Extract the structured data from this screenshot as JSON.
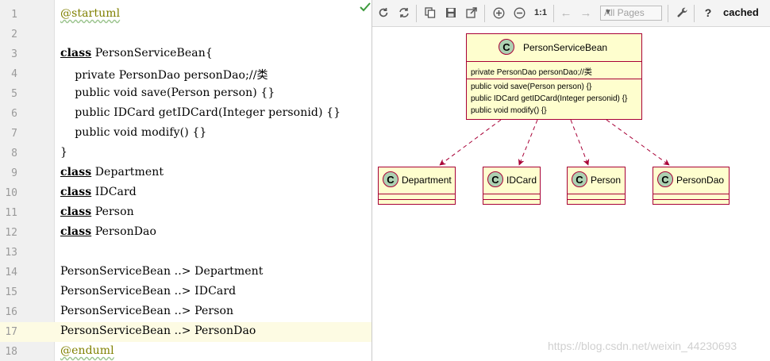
{
  "editor": {
    "lines": [
      {
        "num": "1",
        "text": "@startuml"
      },
      {
        "num": "2",
        "text": ""
      },
      {
        "num": "3",
        "kw": "class",
        "text": " PersonServiceBean{"
      },
      {
        "num": "4",
        "text": "    private PersonDao personDao;//类"
      },
      {
        "num": "5",
        "text": "    public void save(Person person) {}"
      },
      {
        "num": "6",
        "text": "    public IDCard getIDCard(Integer personid) {}"
      },
      {
        "num": "7",
        "text": "    public void modify() {}"
      },
      {
        "num": "8",
        "text": "}"
      },
      {
        "num": "9",
        "kw": "class",
        "text": " Department"
      },
      {
        "num": "10",
        "kw": "class",
        "text": " IDCard"
      },
      {
        "num": "11",
        "kw": "class",
        "text": " Person"
      },
      {
        "num": "12",
        "kw": "class",
        "text": " PersonDao"
      },
      {
        "num": "13",
        "text": ""
      },
      {
        "num": "14",
        "text": "PersonServiceBean ..> Department"
      },
      {
        "num": "15",
        "text": "PersonServiceBean ..> IDCard"
      },
      {
        "num": "16",
        "text": "PersonServiceBean ..> Person"
      },
      {
        "num": "17",
        "text": "PersonServiceBean ..> PersonDao"
      },
      {
        "num": "18",
        "text": "@enduml"
      }
    ],
    "current_line": 17
  },
  "toolbar": {
    "pages_select": "All Pages",
    "zoom_actual": "1:1",
    "help": "?",
    "status": "cached",
    "icons": [
      "refresh-icon",
      "reload-icon",
      "copy-icon",
      "save-icon",
      "export-icon",
      "zoom-in-icon",
      "zoom-out-icon",
      "arrow-left-icon",
      "arrow-right-icon",
      "wrench-icon"
    ]
  },
  "diagram": {
    "main_class": {
      "name": "PersonServiceBean",
      "fields": [
        "private PersonDao personDao;//类"
      ],
      "methods": [
        "public void save(Person person) {}",
        "public IDCard getIDCard(Integer personid) {}",
        "public void modify() {}"
      ]
    },
    "dependents": [
      "Department",
      "IDCard",
      "Person",
      "PersonDao"
    ],
    "class_marker": "C",
    "colors": {
      "class_fill": "#fefece",
      "border": "#a80036",
      "circle": "#add1b2"
    }
  },
  "watermark": "https://blog.csdn.net/weixin_44230693"
}
